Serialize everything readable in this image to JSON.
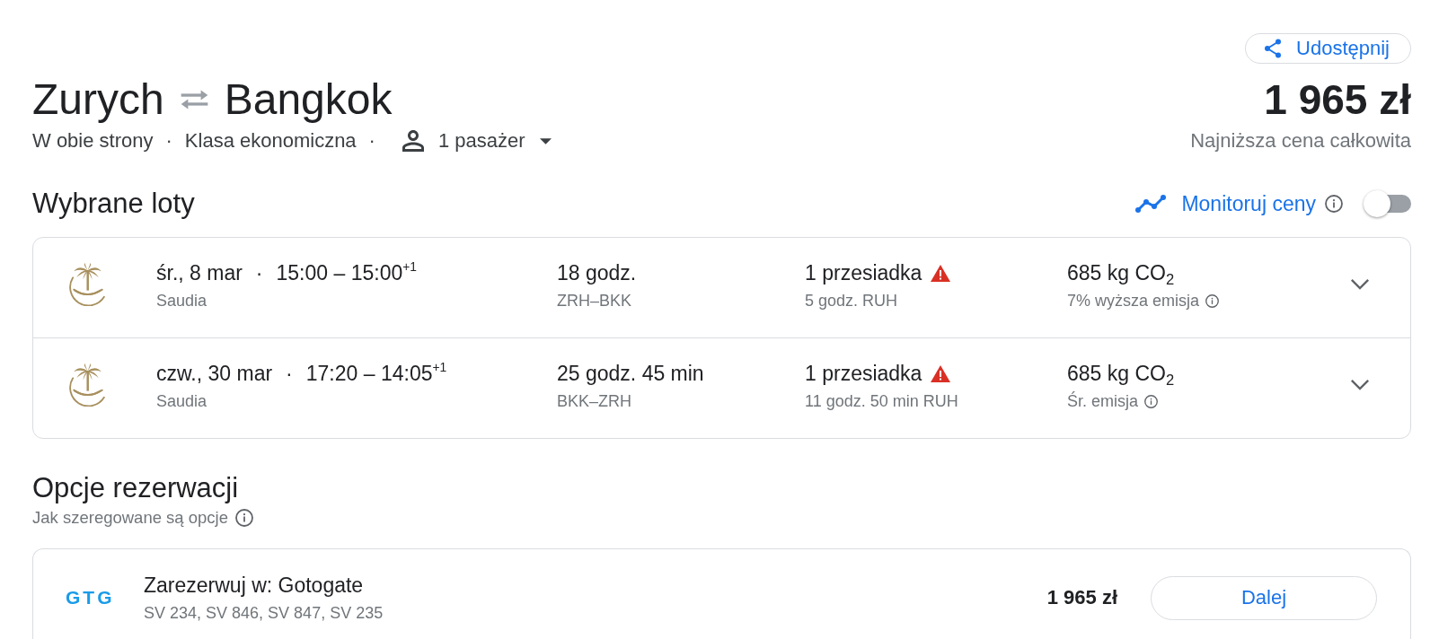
{
  "share_button": {
    "label": "Udostępnij"
  },
  "route": {
    "origin": "Zurych",
    "destination": "Bangkok"
  },
  "trip_options": [
    {
      "kind": "text",
      "label": "W obie strony"
    },
    {
      "kind": "separator",
      "label": "·"
    },
    {
      "kind": "text",
      "label": "Klasa ekonomiczna"
    },
    {
      "kind": "separator",
      "label": "·"
    },
    {
      "kind": "dropdown",
      "label": "1 pasażer"
    }
  ],
  "price": {
    "amount": "1 965 zł",
    "caption": "Najniższa cena całkowita"
  },
  "selected_flights": {
    "title": "Wybrane loty",
    "price_tracking": {
      "label": "Monitoruj ceny",
      "on": false
    },
    "flights": [
      {
        "date": "śr., 8 mar",
        "separator": "·",
        "times": "15:00 – 15:00$^{+1}$",
        "airline": "Saudia",
        "duration": "18 godz.",
        "route": "ZRH–BKK",
        "stops": "1 przesiadka",
        "warning": true,
        "layover": "5 godz. RUH",
        "emissions": "685 kg CO$_{2}$",
        "emissions_note": "7% wyższa emisja",
        "expanded": false
      },
      {
        "date": "czw., 30 mar",
        "separator": "·",
        "times": "17:20 – 14:05$^{+1}$",
        "airline": "Saudia",
        "duration": "25 godz. 45 min",
        "route": "BKK–ZRH",
        "stops": "1 przesiadka",
        "warning": true,
        "layover": "11 godz. 50 min RUH",
        "emissions": "685 kg CO$_{2}$",
        "emissions_note": "Śr. emisja",
        "expanded": false
      }
    ]
  },
  "booking": {
    "title": "Opcje rezerwacji",
    "subtitle": "Jak szeregowane są opcje",
    "options": [
      {
        "logo_text": "GTG",
        "provider": "Zarezerwuj w: Gotogate",
        "flight_numbers": "SV 234, SV 846, SV 847, SV 235",
        "price": "1 965 zł",
        "button": "Dalej"
      }
    ]
  }
}
